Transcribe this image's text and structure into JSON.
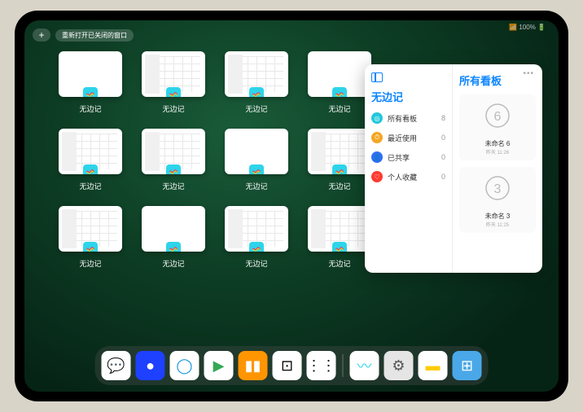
{
  "status": "📶 100% 🔋",
  "topbar": {
    "plus": "+",
    "reopen": "重新打开已关闭的窗口"
  },
  "tile_label": "无边记",
  "tiles": [
    {
      "variant": "blank"
    },
    {
      "variant": "cal"
    },
    {
      "variant": "cal"
    },
    {
      "variant": "blank"
    },
    {
      "variant": "cal"
    },
    {
      "variant": "cal"
    },
    {
      "variant": "blank"
    },
    {
      "variant": "cal"
    },
    {
      "variant": "cal"
    },
    {
      "variant": "blank"
    },
    {
      "variant": "cal"
    },
    {
      "variant": "cal"
    }
  ],
  "panel": {
    "left_title": "无边记",
    "rows": [
      {
        "icon": "c1",
        "glyph": "◎",
        "label": "所有看板",
        "count": "8"
      },
      {
        "icon": "c2",
        "glyph": "⏱",
        "label": "最近使用",
        "count": "0"
      },
      {
        "icon": "c3",
        "glyph": "👤",
        "label": "已共享",
        "count": "0"
      },
      {
        "icon": "c4",
        "glyph": "♡",
        "label": "个人收藏",
        "count": "0"
      }
    ],
    "right_title": "所有看板",
    "cards": [
      {
        "sketch": "6",
        "title": "未命名 6",
        "sub": "昨天 11:26"
      },
      {
        "sketch": "3",
        "title": "未命名 3",
        "sub": "昨天 11:25"
      }
    ]
  },
  "dock": [
    {
      "name": "wechat",
      "bg": "#fff",
      "glyph": "💬",
      "color": "#07c160"
    },
    {
      "name": "quark",
      "bg": "#1e40ff",
      "glyph": "●",
      "color": "#fff"
    },
    {
      "name": "qqbrowser",
      "bg": "#fff",
      "glyph": "◯",
      "color": "#1296db"
    },
    {
      "name": "play",
      "bg": "#fff",
      "glyph": "▶",
      "color": "#34a853"
    },
    {
      "name": "books",
      "bg": "#ff9500",
      "glyph": "▮▮",
      "color": "#fff"
    },
    {
      "name": "dice",
      "bg": "#fff",
      "glyph": "⊡",
      "color": "#000"
    },
    {
      "name": "nodes",
      "bg": "#fff",
      "glyph": "⋮⋮",
      "color": "#000"
    },
    {
      "name": "sep"
    },
    {
      "name": "freeform",
      "bg": "#fff",
      "glyph": "〰",
      "color": "#2dd4ea"
    },
    {
      "name": "settings",
      "bg": "#e5e5e5",
      "glyph": "⚙",
      "color": "#555"
    },
    {
      "name": "notes",
      "bg": "#fff",
      "glyph": "▬",
      "color": "#ffcc00"
    },
    {
      "name": "folder",
      "bg": "#4aa8e8",
      "glyph": "⊞",
      "color": "#fff"
    }
  ]
}
